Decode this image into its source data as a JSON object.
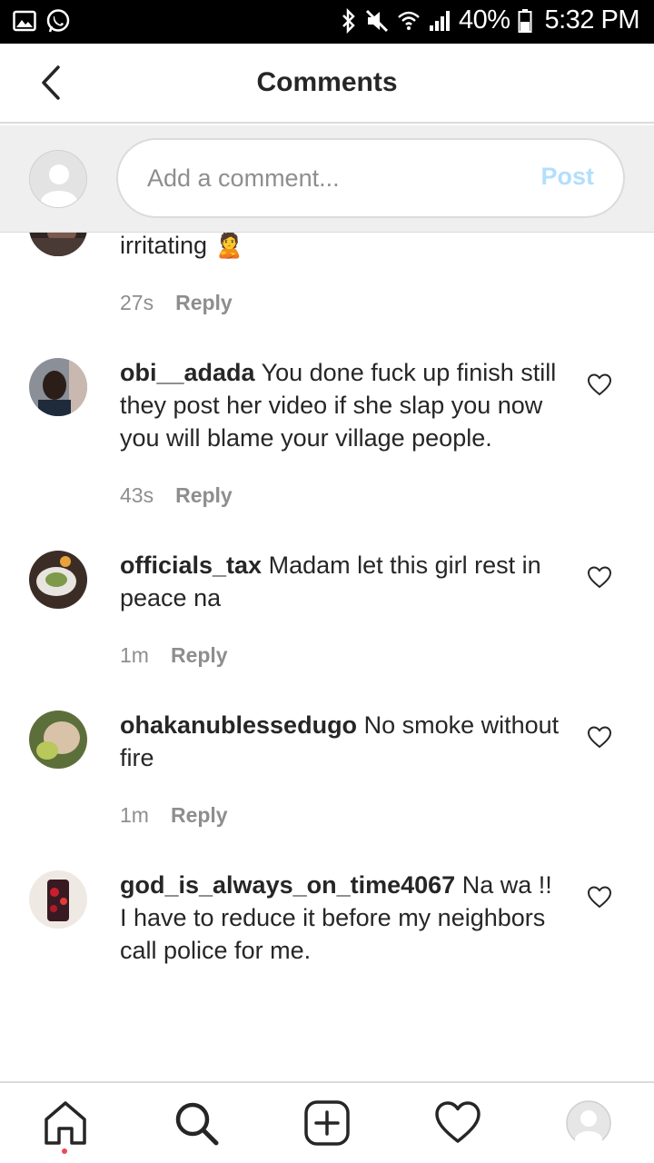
{
  "status_bar": {
    "battery_percent": "40%",
    "time": "5:32 PM",
    "icons": [
      "gallery-icon",
      "whatsapp-icon",
      "bluetooth-icon",
      "mute-icon",
      "wifi-icon",
      "signal-icon",
      "battery-icon"
    ]
  },
  "header": {
    "title": "Comments",
    "back_icon": "chevron-left-icon"
  },
  "composer": {
    "placeholder": "Add a comment...",
    "post_label": "Post",
    "post_color": "#b2dffc"
  },
  "comments": [
    {
      "username": "",
      "text": "irritating 🙎",
      "time": "27s",
      "reply_label": "Reply"
    },
    {
      "username": "obi__adada",
      "text": "You done fuck up finish still they post her video if she slap you now you will blame your village people.",
      "time": "43s",
      "reply_label": "Reply"
    },
    {
      "username": "officials_tax",
      "text": "Madam let this girl rest in peace na",
      "time": "1m",
      "reply_label": "Reply"
    },
    {
      "username": "ohakanublessedugo",
      "text": "No smoke without fire",
      "time": "1m",
      "reply_label": "Reply"
    },
    {
      "username": "god_is_always_on_time4067",
      "text": "Na wa !! I have to reduce it before my neighbors call police for me.",
      "time": "",
      "reply_label": ""
    }
  ],
  "bottom_nav": {
    "items": [
      "home-icon",
      "search-icon",
      "new-post-icon",
      "activity-icon",
      "profile-icon"
    ],
    "notification_dot_color": "#ed4956"
  }
}
